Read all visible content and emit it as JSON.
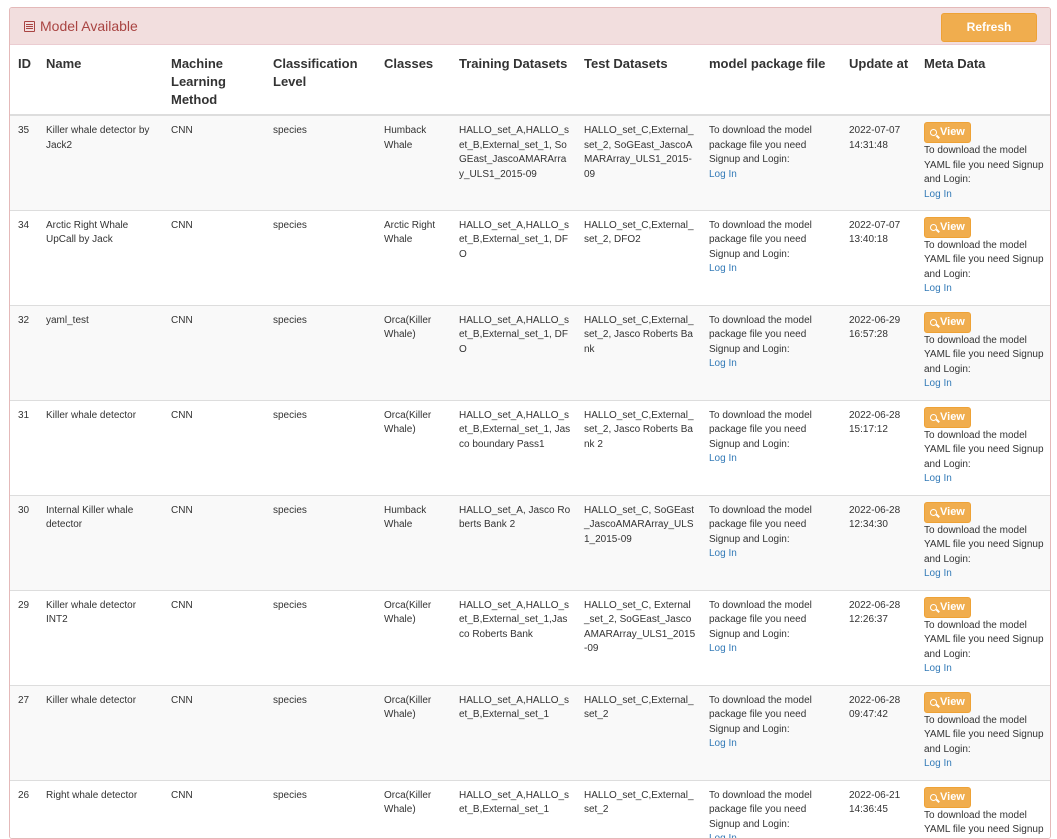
{
  "header": {
    "title": "Model Available",
    "refresh_label": "Refresh"
  },
  "columns": [
    "ID",
    "Name",
    "Machine Learning Method",
    "Classification Level",
    "Classes",
    "Training Datasets",
    "Test Datasets",
    "model package file",
    "Update at",
    "Meta Data"
  ],
  "package_text": "To download the model package file you need Signup and Login:",
  "meta_text": "To download the model YAML file you need Signup and Login:",
  "login_label": "Log In",
  "view_label": "View",
  "rows": [
    {
      "id": "35",
      "name": "Killer whale detector by Jack2",
      "method": "CNN",
      "level": "species",
      "classes": "Humback Whale",
      "training": "HALLO_set_A,HALLO_set_B,External_set_1, SoGEast_JascoAMARArray_ULS1_2015-09",
      "test": "HALLO_set_C,External_set_2, SoGEast_JascoAMARArray_ULS1_2015-09",
      "updated": "2022-07-07 14:31:48"
    },
    {
      "id": "34",
      "name": "Arctic Right Whale UpCall by Jack",
      "method": "CNN",
      "level": "species",
      "classes": "Arctic Right Whale",
      "training": "HALLO_set_A,HALLO_set_B,External_set_1, DFO",
      "test": "HALLO_set_C,External_set_2, DFO2",
      "updated": "2022-07-07 13:40:18"
    },
    {
      "id": "32",
      "name": "yaml_test",
      "method": "CNN",
      "level": "species",
      "classes": "Orca(Killer Whale)",
      "training": "HALLO_set_A,HALLO_set_B,External_set_1, DFO",
      "test": "HALLO_set_C,External_set_2, Jasco Roberts Bank",
      "updated": "2022-06-29 16:57:28"
    },
    {
      "id": "31",
      "name": "Killer whale detector",
      "method": "CNN",
      "level": "species",
      "classes": "Orca(Killer Whale)",
      "training": "HALLO_set_A,HALLO_set_B,External_set_1, Jasco boundary Pass1",
      "test": "HALLO_set_C,External_set_2, Jasco Roberts Bank 2",
      "updated": "2022-06-28 15:17:12"
    },
    {
      "id": "30",
      "name": "Internal Killer whale detector",
      "method": "CNN",
      "level": "species",
      "classes": "Humback Whale",
      "training": "HALLO_set_A, Jasco Roberts Bank 2",
      "test": "HALLO_set_C, SoGEast_JascoAMARArray_ULS1_2015-09",
      "updated": "2022-06-28 12:34:30"
    },
    {
      "id": "29",
      "name": "Killer whale detector INT2",
      "method": "CNN",
      "level": "species",
      "classes": "Orca(Killer Whale)",
      "training": "HALLO_set_A,HALLO_set_B,External_set_1,Jasco Roberts Bank",
      "test": "HALLO_set_C, External_set_2, SoGEast_JascoAMARArray_ULS1_2015-09",
      "updated": "2022-06-28 12:26:37"
    },
    {
      "id": "27",
      "name": "Killer whale detector",
      "method": "CNN",
      "level": "species",
      "classes": "Orca(Killer Whale)",
      "training": "HALLO_set_A,HALLO_set_B,External_set_1",
      "test": "HALLO_set_C,External_set_2",
      "updated": "2022-06-28 09:47:42"
    },
    {
      "id": "26",
      "name": "Right whale detector",
      "method": "CNN",
      "level": "species",
      "classes": "Orca(Killer Whale)",
      "training": "HALLO_set_A,HALLO_set_B,External_set_1",
      "test": "HALLO_set_C,External_set_2",
      "updated": "2022-06-21 14:36:45"
    }
  ]
}
